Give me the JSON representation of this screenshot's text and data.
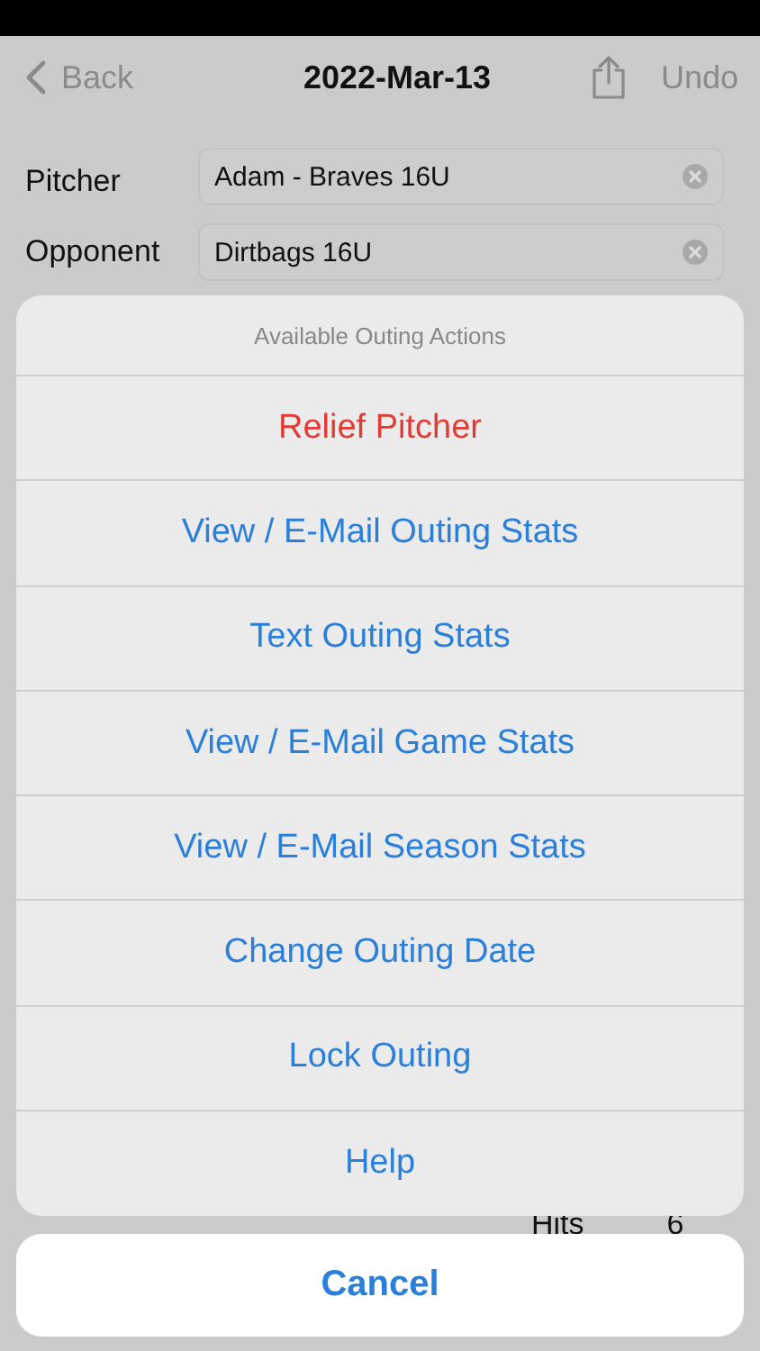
{
  "nav": {
    "back": "Back",
    "title": "2022-Mar-13",
    "undo": "Undo"
  },
  "fields": [
    {
      "label": "Pitcher",
      "value": "Adam - Braves 16U"
    },
    {
      "label": "Opponent",
      "value": "Dirtbags 16U"
    }
  ],
  "behind": {
    "label": "Hits",
    "value": "6"
  },
  "sheet": {
    "title": "Available Outing Actions",
    "actions": [
      {
        "label": "Relief Pitcher",
        "kind": "destructive"
      },
      {
        "label": "View / E-Mail Outing Stats",
        "kind": "default"
      },
      {
        "label": "Text Outing Stats",
        "kind": "default"
      },
      {
        "label": "View / E-Mail Game Stats",
        "kind": "default"
      },
      {
        "label": "View / E-Mail Season Stats",
        "kind": "default"
      },
      {
        "label": "Change Outing Date",
        "kind": "default"
      },
      {
        "label": "Lock Outing",
        "kind": "default"
      },
      {
        "label": "Help",
        "kind": "default"
      }
    ],
    "cancel": "Cancel"
  }
}
